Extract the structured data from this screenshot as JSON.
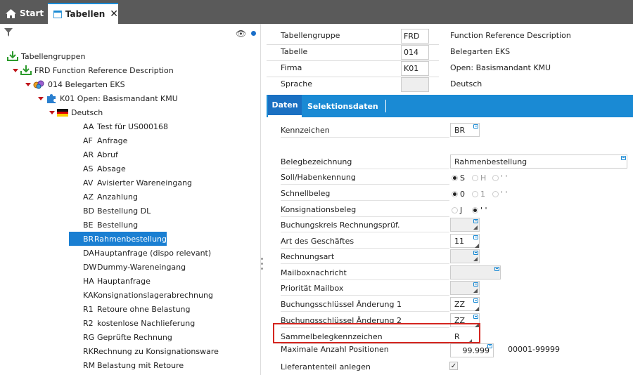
{
  "tabs": [
    {
      "label": "Start",
      "icon": "home-icon"
    },
    {
      "label": "Tabellen",
      "icon": "window-icon",
      "close": "✕"
    }
  ],
  "tree": {
    "root": "Tabellengruppen",
    "group": "FRD  Function Reference Description",
    "table": "014  Belegarten EKS",
    "firm": "K01 Open: Basismandant KMU",
    "lang": "Deutsch",
    "items": [
      {
        "code": "AA",
        "label": "Test für US000168"
      },
      {
        "code": "AF",
        "label": "Anfrage"
      },
      {
        "code": "AR",
        "label": "Abruf"
      },
      {
        "code": "AS",
        "label": "Absage"
      },
      {
        "code": "AV",
        "label": "Avisierter Wareneingang"
      },
      {
        "code": "AZ",
        "label": "Anzahlung"
      },
      {
        "code": "BD",
        "label": "Bestellung DL"
      },
      {
        "code": "BE",
        "label": "Bestellung"
      },
      {
        "code": "BR",
        "label": "Rahmenbestellung"
      },
      {
        "code": "DA",
        "label": "Hauptanfrage (dispo relevant)"
      },
      {
        "code": "DW",
        "label": "Dummy-Wareneingang"
      },
      {
        "code": "HA",
        "label": "Hauptanfrage"
      },
      {
        "code": "KA",
        "label": "Konsignationslagerabrechnung"
      },
      {
        "code": "R1",
        "label": "Retoure ohne Belastung"
      },
      {
        "code": "R2",
        "label": "kostenlose Nachlieferung"
      },
      {
        "code": "RG",
        "label": "Geprüfte Rechnung"
      },
      {
        "code": "RK",
        "label": "Rechnung zu Konsignationsware"
      },
      {
        "code": "RM",
        "label": "Belastung mit Retoure"
      }
    ]
  },
  "header": [
    {
      "label": "Tabellengruppe",
      "value": "FRD",
      "desc": "Function Reference Description"
    },
    {
      "label": "Tabelle",
      "value": "014",
      "desc": "Belegarten EKS"
    },
    {
      "label": "Firma",
      "value": "K01",
      "desc": "Open: Basismandant KMU"
    },
    {
      "label": "Sprache",
      "value": "",
      "desc": "Deutsch"
    }
  ],
  "subtabs": {
    "active": "Daten",
    "other": "Selektionsdaten"
  },
  "fields": {
    "kennzeichen": {
      "label": "Kennzeichen",
      "value": "BR"
    },
    "belegbez": {
      "label": "Belegbezeichnung",
      "value": "Rahmenbestellung"
    },
    "sollhaben": {
      "label": "Soll/Habenkennung",
      "opt1": "S",
      "opt2": "H",
      "opt3": "' '"
    },
    "schnell": {
      "label": "Schnellbeleg",
      "opt1": "0",
      "opt2": "1",
      "opt3": "' '"
    },
    "konsig": {
      "label": "Konsignationsbeleg",
      "opt1": "J",
      "opt2": "' '"
    },
    "bkrech": {
      "label": "Buchungskreis Rechnungsprüf.",
      "value": ""
    },
    "artgesch": {
      "label": "Art des Geschäftes",
      "value": "11"
    },
    "rechart": {
      "label": "Rechnungsart",
      "value": ""
    },
    "mailbox": {
      "label": "Mailboxnachricht",
      "value": ""
    },
    "prio": {
      "label": "Priorität Mailbox",
      "value": ""
    },
    "bs1": {
      "label": "Buchungsschlüssel Änderung 1",
      "value": "ZZ"
    },
    "bs2": {
      "label": "Buchungsschlüssel Änderung 2",
      "value": "ZZ"
    },
    "sammel": {
      "label": "Sammelbelegkennzeichen",
      "value": "R"
    },
    "maxpos": {
      "label": "Maximale Anzahl Positionen",
      "value": "99.999",
      "range": "00001-99999"
    },
    "lief": {
      "label": "Lieferantenteil anlegen",
      "check": "✓"
    }
  },
  "colors": {
    "accent": "#1a8ad4",
    "selected": "#1a7fd2",
    "highlight": "#d4251f",
    "tabbar": "#5a5a5a"
  }
}
